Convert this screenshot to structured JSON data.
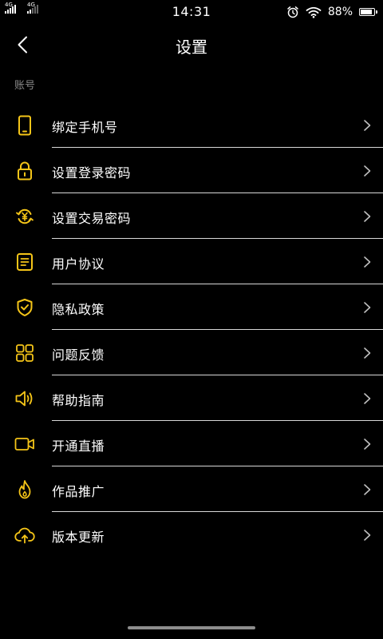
{
  "status_bar": {
    "signal1_label": "4G",
    "signal2_label": "4G",
    "time": "14:31",
    "battery": "88%",
    "battery_level": 0.88
  },
  "nav": {
    "title": "设置"
  },
  "section": {
    "label": "账号"
  },
  "menu": {
    "items": [
      {
        "label": "绑定手机号",
        "icon": "phone-icon"
      },
      {
        "label": "设置登录密码",
        "icon": "lock-icon"
      },
      {
        "label": "设置交易密码",
        "icon": "yuan-exchange-icon"
      },
      {
        "label": "用户协议",
        "icon": "document-icon"
      },
      {
        "label": "隐私政策",
        "icon": "shield-check-icon"
      },
      {
        "label": "问题反馈",
        "icon": "grid-icon"
      },
      {
        "label": "帮助指南",
        "icon": "speaker-icon"
      },
      {
        "label": "开通直播",
        "icon": "video-camera-icon"
      },
      {
        "label": "作品推广",
        "icon": "flame-icon"
      },
      {
        "label": "版本更新",
        "icon": "cloud-upload-icon"
      }
    ]
  },
  "colors": {
    "accent": "#f5c518",
    "background": "#000000",
    "text": "#ffffff",
    "secondary_text": "#8a8a8a",
    "divider": "#d8d8d8"
  }
}
